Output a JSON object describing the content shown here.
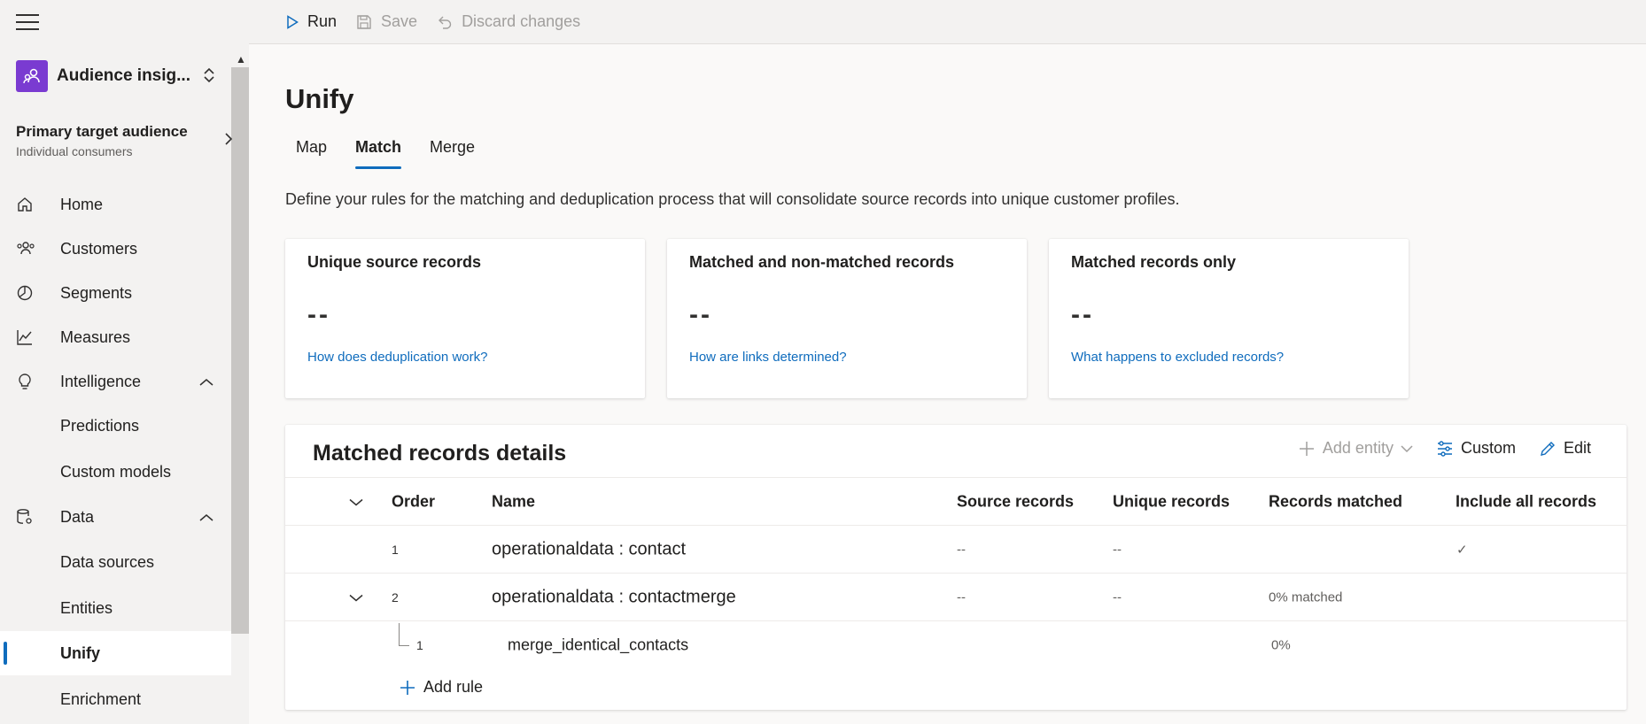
{
  "sidebar": {
    "environment": {
      "name": "Audience insig...",
      "icon": "audience-insights-icon"
    },
    "audience": {
      "title": "Primary target audience",
      "subtitle": "Individual consumers"
    },
    "items": [
      {
        "label": "Home",
        "icon": "home-icon"
      },
      {
        "label": "Customers",
        "icon": "people-icon"
      },
      {
        "label": "Segments",
        "icon": "segments-pie-icon"
      },
      {
        "label": "Measures",
        "icon": "line-chart-icon"
      },
      {
        "label": "Intelligence",
        "icon": "lightbulb-icon",
        "expanded": true
      },
      {
        "label": "Predictions"
      },
      {
        "label": "Custom models"
      },
      {
        "label": "Data",
        "icon": "database-gear-icon",
        "expanded": true
      },
      {
        "label": "Data sources"
      },
      {
        "label": "Entities"
      },
      {
        "label": "Unify",
        "selected": true
      },
      {
        "label": "Enrichment"
      }
    ]
  },
  "toolbar": {
    "run_label": "Run",
    "save_label": "Save",
    "discard_label": "Discard changes"
  },
  "page": {
    "title": "Unify",
    "tabs": [
      {
        "label": "Map"
      },
      {
        "label": "Match",
        "active": true
      },
      {
        "label": "Merge"
      }
    ],
    "description": "Define your rules for the matching and deduplication process that will consolidate source records into unique customer profiles."
  },
  "cards": [
    {
      "title": "Unique source records",
      "value": "--",
      "link": "How does deduplication work?"
    },
    {
      "title": "Matched and non-matched records",
      "value": "--",
      "link": "How are links determined?"
    },
    {
      "title": "Matched records only",
      "value": "--",
      "link": "What happens to excluded records?"
    }
  ],
  "details": {
    "title": "Matched records details",
    "actions": {
      "add_entity": "Add entity",
      "custom": "Custom",
      "edit": "Edit"
    },
    "columns": {
      "order": "Order",
      "name": "Name",
      "source": "Source records",
      "unique": "Unique records",
      "matched": "Records matched",
      "include": "Include all records"
    },
    "rows": [
      {
        "order": "1",
        "name": "operationaldata : contact",
        "source": "--",
        "unique": "--",
        "matched": "",
        "include": "✓"
      },
      {
        "order": "2",
        "name": "operationaldata : contactmerge",
        "source": "--",
        "unique": "--",
        "matched": "0% matched",
        "include": ""
      }
    ],
    "rule": {
      "order": "1",
      "name": "merge_identical_contacts",
      "matched": "0%"
    },
    "add_rule": "Add rule"
  },
  "colors": {
    "accent": "#0f6cbd",
    "env_icon": "#7a3bd1"
  }
}
